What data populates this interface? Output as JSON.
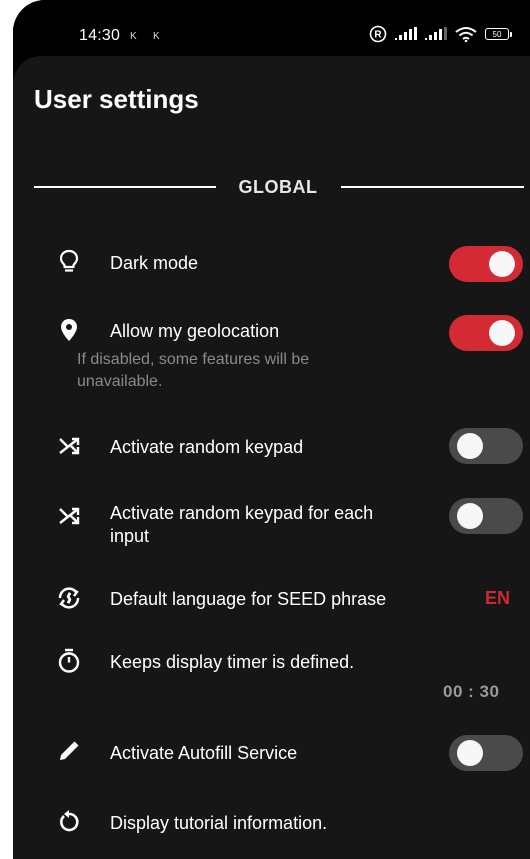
{
  "status_bar": {
    "time": "14:30",
    "notification_glyphs": [
      "K",
      "K"
    ],
    "battery_level": "50",
    "icons": [
      "registered-icon",
      "signal-icon",
      "signal-icon",
      "wifi-icon",
      "battery-icon"
    ]
  },
  "header": {
    "title": "User settings"
  },
  "section": {
    "title": "GLOBAL"
  },
  "settings": {
    "dark_mode": {
      "label": "Dark mode",
      "icon": "lightbulb-icon",
      "enabled": true
    },
    "geolocation": {
      "label": "Allow my geolocation",
      "description": "If disabled, some features will be unavailable.",
      "icon": "location-pin-icon",
      "enabled": true
    },
    "random_keypad": {
      "label": "Activate random keypad",
      "icon": "shuffle-icon",
      "enabled": false
    },
    "random_keypad_each": {
      "label": "Activate random keypad for each input",
      "icon": "shuffle-icon",
      "enabled": false
    },
    "seed_language": {
      "label": "Default language for SEED phrase",
      "icon": "language-sync-icon",
      "value": "EN"
    },
    "display_timer": {
      "label": "Keeps display timer is defined.",
      "icon": "timer-icon",
      "value": "00 : 30"
    },
    "autofill": {
      "label": "Activate Autofill Service",
      "icon": "pencil-icon",
      "enabled": false
    },
    "tutorial": {
      "label": "Display tutorial information.",
      "icon": "restart-icon"
    }
  },
  "colors": {
    "background": "#161616",
    "toggle_on": "#d42a33",
    "toggle_off": "#4a4a4a",
    "accent": "#d0282f"
  }
}
